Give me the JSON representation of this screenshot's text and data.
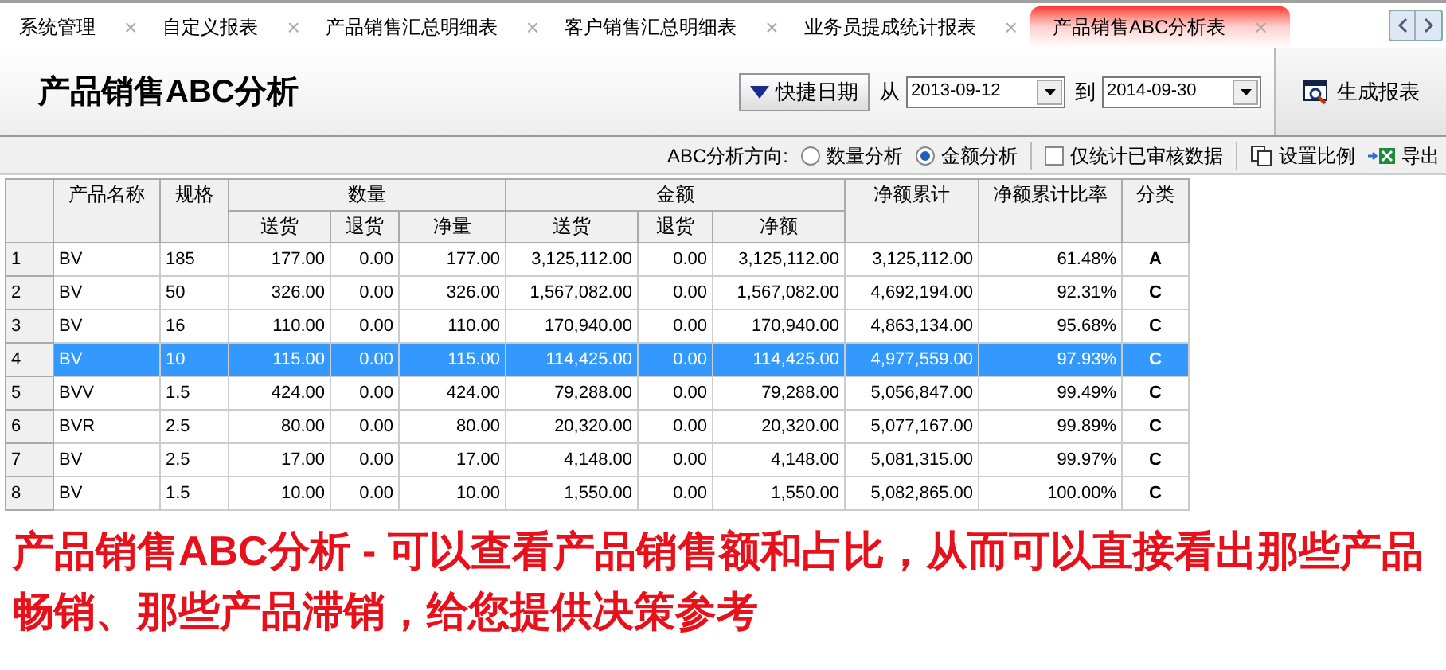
{
  "tabs": [
    {
      "label": "系统管理",
      "selected": false,
      "close": "×"
    },
    {
      "label": "自定义报表",
      "selected": false,
      "close": "×"
    },
    {
      "label": "产品销售汇总明细表",
      "selected": false,
      "close": "×"
    },
    {
      "label": "客户销售汇总明细表",
      "selected": false,
      "close": "×"
    },
    {
      "label": "业务员提成统计报表",
      "selected": false,
      "close": "×"
    },
    {
      "label": "产品销售ABC分析表",
      "selected": true,
      "close": "×"
    }
  ],
  "header": {
    "title": "产品销售ABC分析",
    "quick_date_button": "快捷日期",
    "from_label": "从",
    "from_date": "2013-09-12",
    "to_label": "到",
    "to_date": "2014-09-30",
    "generate_button": "生成报表"
  },
  "toolbar": {
    "direction_label": "ABC分析方向:",
    "options": [
      {
        "label": "数量分析",
        "selected": false
      },
      {
        "label": "金额分析",
        "selected": true
      }
    ],
    "audited_only": {
      "label": "仅统计已审核数据",
      "checked": false
    },
    "set_ratio_button": "设置比例",
    "export_button": "导出"
  },
  "table": {
    "columns": [
      {
        "label": "产品名称"
      },
      {
        "label": "规格"
      },
      {
        "label": "数量",
        "colspan": 3,
        "children": [
          "送货",
          "退货",
          "净量"
        ]
      },
      {
        "label": "金额",
        "colspan": 3,
        "children": [
          "送货",
          "退货",
          "净额"
        ]
      },
      {
        "label": "净额累计"
      },
      {
        "label": "净额累计比率"
      },
      {
        "label": "分类"
      }
    ],
    "rows": [
      {
        "index": "1",
        "cells": [
          "BV",
          "185",
          "177.00",
          "0.00",
          "177.00",
          "3,125,112.00",
          "0.00",
          "3,125,112.00",
          "3,125,112.00",
          "61.48%",
          "A"
        ],
        "selected": false
      },
      {
        "index": "2",
        "cells": [
          "BV",
          "50",
          "326.00",
          "0.00",
          "326.00",
          "1,567,082.00",
          "0.00",
          "1,567,082.00",
          "4,692,194.00",
          "92.31%",
          "C"
        ],
        "selected": false
      },
      {
        "index": "3",
        "cells": [
          "BV",
          "16",
          "110.00",
          "0.00",
          "110.00",
          "170,940.00",
          "0.00",
          "170,940.00",
          "4,863,134.00",
          "95.68%",
          "C"
        ],
        "selected": false
      },
      {
        "index": "4",
        "cells": [
          "BV",
          "10",
          "115.00",
          "0.00",
          "115.00",
          "114,425.00",
          "0.00",
          "114,425.00",
          "4,977,559.00",
          "97.93%",
          "C"
        ],
        "selected": true
      },
      {
        "index": "5",
        "cells": [
          "BVV",
          "1.5",
          "424.00",
          "0.00",
          "424.00",
          "79,288.00",
          "0.00",
          "79,288.00",
          "5,056,847.00",
          "99.49%",
          "C"
        ],
        "selected": false
      },
      {
        "index": "6",
        "cells": [
          "BVR",
          "2.5",
          "80.00",
          "0.00",
          "80.00",
          "20,320.00",
          "0.00",
          "20,320.00",
          "5,077,167.00",
          "99.89%",
          "C"
        ],
        "selected": false
      },
      {
        "index": "7",
        "cells": [
          "BV",
          "2.5",
          "17.00",
          "0.00",
          "17.00",
          "4,148.00",
          "0.00",
          "4,148.00",
          "5,081,315.00",
          "99.97%",
          "C"
        ],
        "selected": false
      },
      {
        "index": "8",
        "cells": [
          "BV",
          "1.5",
          "10.00",
          "0.00",
          "10.00",
          "1,550.00",
          "0.00",
          "1,550.00",
          "5,082,865.00",
          "100.00%",
          "C"
        ],
        "selected": false
      }
    ]
  },
  "caption": "产品销售ABC分析 - 可以查看产品销售额和占比，从而可以直接看出那些产品畅销、那些产品滞销，给您提供决策参考"
}
